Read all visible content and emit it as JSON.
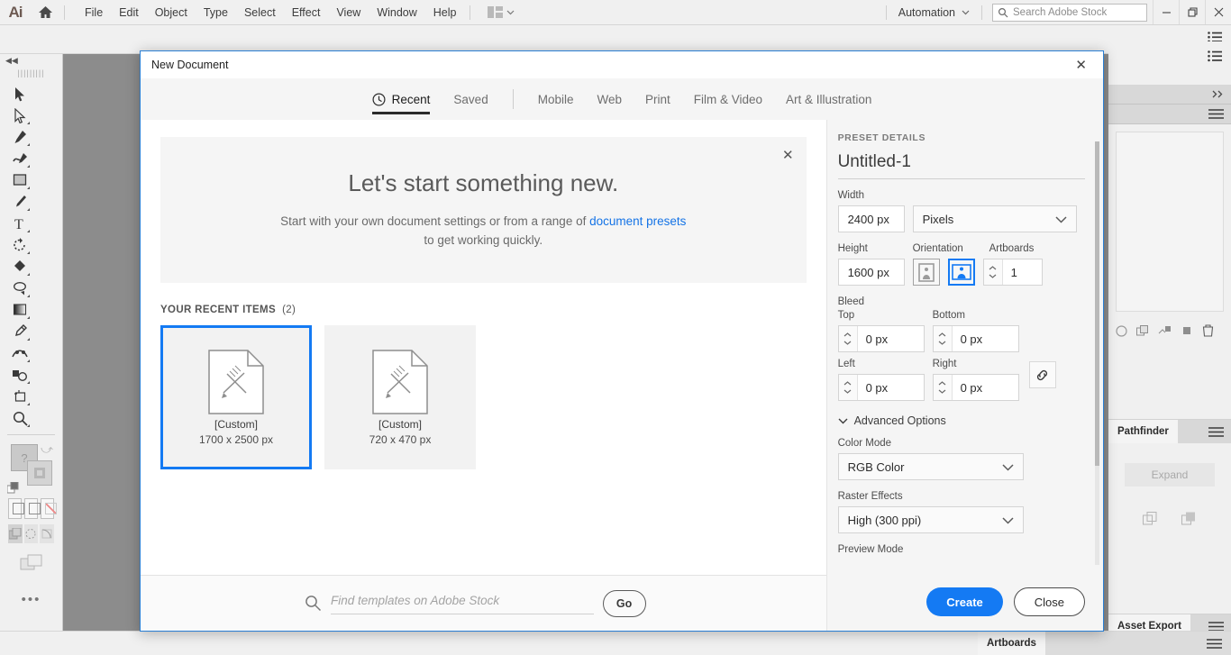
{
  "app": {
    "logo": "Ai",
    "menus": [
      "File",
      "Edit",
      "Object",
      "Type",
      "Select",
      "Effect",
      "View",
      "Window",
      "Help"
    ],
    "workspace_label": "Automation",
    "stock_search_placeholder": "Search Adobe Stock"
  },
  "toolbar": {
    "tools": [
      "selection-tool",
      "direct-selection-tool",
      "pen-tool",
      "curvature-tool",
      "rectangle-tool",
      "paintbrush-tool",
      "type-tool",
      "rotate-tool",
      "shaper-tool",
      "lasso-tool",
      "gradient-tool",
      "eyedropper-tool",
      "width-tool",
      "shape-builder-tool",
      "artboard-tool",
      "zoom-tool"
    ],
    "fill_label": "?",
    "stroke_label": "?",
    "more_tools": "•••"
  },
  "right_dock": {
    "panels": [
      "Pathfinder",
      "Asset Export",
      "Artboards"
    ],
    "expand_label": "Expand"
  },
  "dialog": {
    "title": "New Document",
    "close_icon": "✕",
    "tabs": [
      {
        "label": "Recent",
        "icon": "clock-icon",
        "active": true
      },
      {
        "label": "Saved",
        "active": false
      },
      {
        "label": "Mobile",
        "active": false
      },
      {
        "label": "Web",
        "active": false
      },
      {
        "label": "Print",
        "active": false
      },
      {
        "label": "Film & Video",
        "active": false
      },
      {
        "label": "Art & Illustration",
        "active": false
      }
    ],
    "hero": {
      "heading": "Let's start something new.",
      "body_before": "Start with your own document settings or from a range of ",
      "link": "document presets",
      "body_after": "to get working quickly.",
      "dismiss_icon": "✕"
    },
    "recent": {
      "heading": "YOUR RECENT ITEMS",
      "count": "(2)",
      "items": [
        {
          "label": "[Custom]",
          "dimensions": "1700 x 2500 px",
          "selected": true
        },
        {
          "label": "[Custom]",
          "dimensions": "720 x 470 px",
          "selected": false
        }
      ]
    },
    "search": {
      "placeholder": "Find templates on Adobe Stock",
      "go_label": "Go"
    },
    "preset": {
      "section_label": "PRESET DETAILS",
      "document_name": "Untitled-1",
      "width_label": "Width",
      "width_value": "2400 px",
      "units_value": "Pixels",
      "height_label": "Height",
      "height_value": "1600 px",
      "orientation_label": "Orientation",
      "orientation_portrait": "portrait-icon",
      "orientation_landscape": "landscape-icon",
      "artboards_label": "Artboards",
      "artboards_value": "1",
      "bleed_label": "Bleed",
      "bleed_top_label": "Top",
      "bleed_top_value": "0 px",
      "bleed_bottom_label": "Bottom",
      "bleed_bottom_value": "0 px",
      "bleed_left_label": "Left",
      "bleed_left_value": "0 px",
      "bleed_right_label": "Right",
      "bleed_right_value": "0 px",
      "link_icon": "link-icon",
      "advanced_label": "Advanced Options",
      "color_mode_label": "Color Mode",
      "color_mode_value": "RGB Color",
      "raster_label": "Raster Effects",
      "raster_value": "High (300 ppi)",
      "preview_label": "Preview Mode",
      "create_label": "Create",
      "close_label": "Close"
    }
  },
  "colors": {
    "accent": "#147af3",
    "link": "#1473e6",
    "dialog_border": "#2a7fd4",
    "canvas": "#8c8c8c"
  }
}
